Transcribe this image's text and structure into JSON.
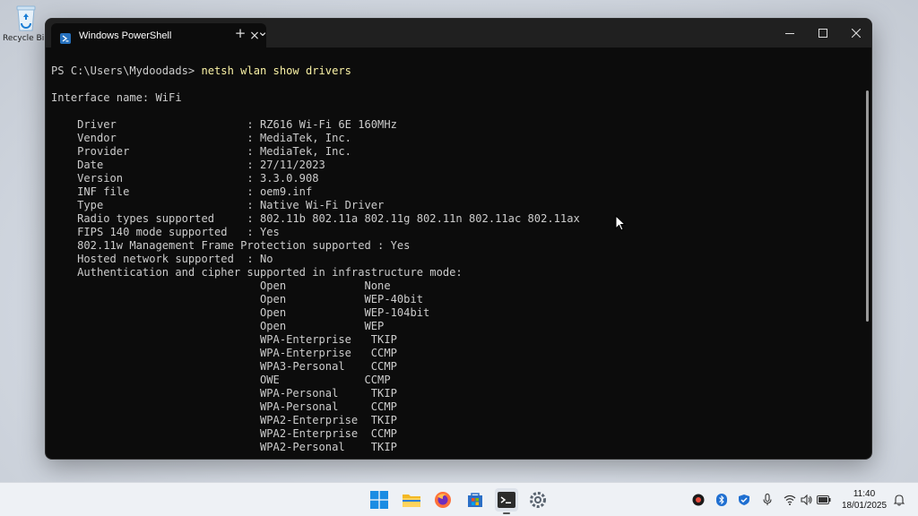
{
  "desktop": {
    "recycle_bin_label": "Recycle Bin"
  },
  "window": {
    "tab_title": "Windows PowerShell",
    "tab_close": "×",
    "new_tab": "+",
    "dropdown": "⌄"
  },
  "terminal": {
    "lines": [
      {
        "prompt": "PS C:\\Users\\Mydoodads> ",
        "command": "netsh wlan show drivers"
      },
      {
        "text": ""
      },
      {
        "text": "Interface name: WiFi"
      },
      {
        "text": ""
      },
      {
        "text": "    Driver                    : RZ616 Wi-Fi 6E 160MHz"
      },
      {
        "text": "    Vendor                    : MediaTek, Inc."
      },
      {
        "text": "    Provider                  : MediaTek, Inc."
      },
      {
        "text": "    Date                      : 27/11/2023"
      },
      {
        "text": "    Version                   : 3.3.0.908"
      },
      {
        "text": "    INF file                  : oem9.inf"
      },
      {
        "text": "    Type                      : Native Wi-Fi Driver"
      },
      {
        "text": "    Radio types supported     : 802.11b 802.11a 802.11g 802.11n 802.11ac 802.11ax"
      },
      {
        "text": "    FIPS 140 mode supported   : Yes"
      },
      {
        "text": "    802.11w Management Frame Protection supported : Yes"
      },
      {
        "text": "    Hosted network supported  : No"
      },
      {
        "text": "    Authentication and cipher supported in infrastructure mode:"
      },
      {
        "text": "                                Open            None"
      },
      {
        "text": "                                Open            WEP-40bit"
      },
      {
        "text": "                                Open            WEP-104bit"
      },
      {
        "text": "                                Open            WEP"
      },
      {
        "text": "                                WPA-Enterprise   TKIP"
      },
      {
        "text": "                                WPA-Enterprise   CCMP"
      },
      {
        "text": "                                WPA3-Personal    CCMP"
      },
      {
        "text": "                                OWE             CCMP"
      },
      {
        "text": "                                WPA-Personal     TKIP"
      },
      {
        "text": "                                WPA-Personal     CCMP"
      },
      {
        "text": "                                WPA2-Enterprise  TKIP"
      },
      {
        "text": "                                WPA2-Enterprise  CCMP"
      },
      {
        "text": "                                WPA2-Personal    TKIP"
      }
    ]
  },
  "taskbar": {
    "apps": [
      "start-icon",
      "file-explorer-icon",
      "firefox-icon",
      "store-icon",
      "terminal-icon",
      "settings-icon"
    ],
    "tray": [
      "app-tray-icon",
      "bluetooth-icon",
      "security-icon",
      "microphone-icon",
      "wifi-icon",
      "volume-icon",
      "battery-icon"
    ],
    "time": "11:40",
    "date": "18/01/2025"
  },
  "colors": {
    "terminal_bg": "#0c0c0c",
    "terminal_fg": "#cccccc",
    "command_fg": "#f9f1a5",
    "titlebar_bg": "#202020"
  }
}
